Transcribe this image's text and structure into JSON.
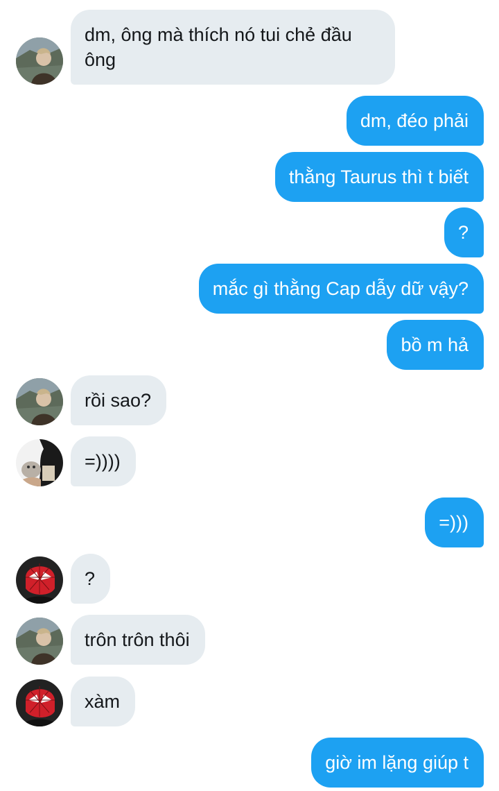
{
  "messages": [
    {
      "text": "dm, ông mà thích nó tui chẻ đầu ông",
      "direction": "incoming",
      "avatar": "avatar-a"
    },
    {
      "text": "dm, đéo phải",
      "direction": "outgoing"
    },
    {
      "text": "thằng Taurus thì t biết",
      "direction": "outgoing"
    },
    {
      "text": "?",
      "direction": "outgoing"
    },
    {
      "text": "mắc gì thằng Cap dẫy dữ vậy?",
      "direction": "outgoing"
    },
    {
      "text": "bồ m hả",
      "direction": "outgoing"
    },
    {
      "text": "rồi sao?",
      "direction": "incoming",
      "avatar": "avatar-a"
    },
    {
      "text": "=))))",
      "direction": "incoming",
      "avatar": "avatar-b"
    },
    {
      "text": "=)))",
      "direction": "outgoing"
    },
    {
      "text": "?",
      "direction": "incoming",
      "avatar": "avatar-c"
    },
    {
      "text": "trôn trôn thôi",
      "direction": "incoming",
      "avatar": "avatar-a"
    },
    {
      "text": "xàm",
      "direction": "incoming",
      "avatar": "avatar-c"
    },
    {
      "text": "giờ im lặng giúp t",
      "direction": "outgoing"
    }
  ],
  "colors": {
    "incoming_bubble": "#e6ecf0",
    "outgoing_bubble": "#1da1f2",
    "incoming_text": "#14171a",
    "outgoing_text": "#ffffff"
  }
}
